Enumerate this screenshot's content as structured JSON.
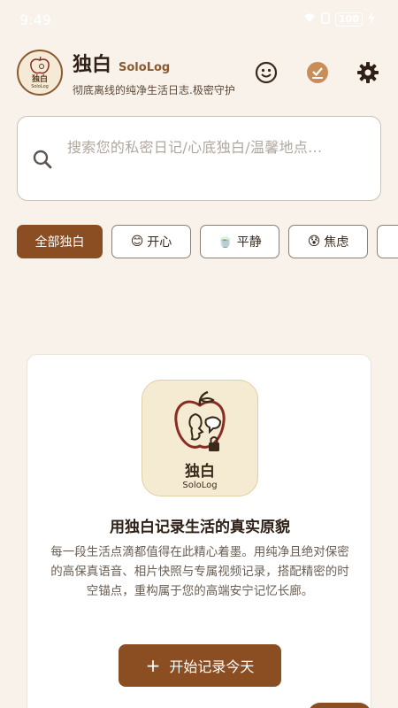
{
  "status_bar": {
    "time": "9:49",
    "battery": "100"
  },
  "header": {
    "title": "独白",
    "subtitle": "SoloLog",
    "tagline": "彻底离线的纯净生活日志.极密守护",
    "logo_mini_title": "独白",
    "logo_mini_sub": "SoloLog",
    "icons": [
      "smiley-icon",
      "checklist-icon",
      "gear-icon"
    ]
  },
  "search": {
    "placeholder": "搜索您的私密日记/心底独白/温馨地点..."
  },
  "filters": [
    {
      "label": "全部独白",
      "emoji": "",
      "active": true
    },
    {
      "label": "开心",
      "emoji": "😊",
      "active": false
    },
    {
      "label": "平静",
      "emoji": "🍵",
      "active": false
    },
    {
      "label": "焦虑",
      "emoji": "😰",
      "active": false
    }
  ],
  "empty_state": {
    "logo_title": "独白",
    "logo_sub": "SoloLog",
    "title": "用独白记录生活的真实原貌",
    "description": "每一段生活点滴都值得在此精心着墨。用纯净且绝对保密的高保真语音、相片快照与专属视频记录，搭配精密的时空锚点，重构属于您的高端安宁记忆长廊。",
    "button_icon": "+",
    "button_label": "开始记录今天"
  },
  "colors": {
    "background": "#f8f2ea",
    "accent": "#8b4e23",
    "card": "#ffffff"
  }
}
